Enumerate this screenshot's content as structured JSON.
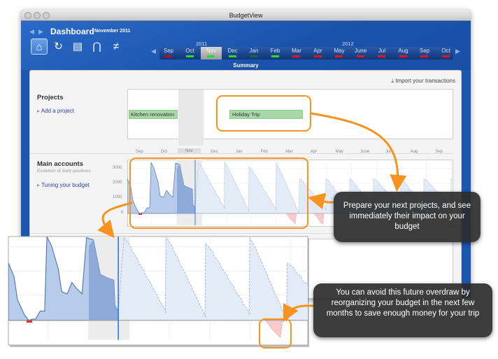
{
  "window": {
    "title": "BudgetView"
  },
  "header": {
    "title": "Dashboard",
    "date": "November 2011",
    "summary": "Summary",
    "tools": [
      {
        "icon": "home-icon",
        "glyph": "⌂"
      },
      {
        "icon": "refresh-icon",
        "glyph": "↻"
      },
      {
        "icon": "document-icon",
        "glyph": "▤"
      },
      {
        "icon": "split-icon",
        "glyph": "⋂"
      },
      {
        "icon": "chart-icon",
        "glyph": "≠"
      }
    ]
  },
  "timeline": {
    "years": [
      "2011",
      "2012"
    ],
    "months": [
      {
        "label": "Sep",
        "status": "#b01010"
      },
      {
        "label": "Oct",
        "status": "#22dd22"
      },
      {
        "label": "Nov",
        "status": "#22dd22",
        "selected": true
      },
      {
        "label": "Dec",
        "status": "#22dd22"
      },
      {
        "label": "Jan",
        "status": "#1d6a1d"
      },
      {
        "label": "Feb",
        "status": "#22dd22"
      },
      {
        "label": "Mar",
        "status": "#ee1111"
      },
      {
        "label": "Apr",
        "status": "#ee1111"
      },
      {
        "label": "May",
        "status": "#ee1111"
      },
      {
        "label": "June",
        "status": "#ee1111"
      },
      {
        "label": "Jul",
        "status": "#ee1111"
      },
      {
        "label": "Aug",
        "status": "#ee1111"
      },
      {
        "label": "Sep",
        "status": "#ee1111"
      },
      {
        "label": "Oct",
        "status": "#ee1111"
      }
    ]
  },
  "import": "Import your transactions",
  "projects": {
    "title": "Projects",
    "add": "Add a project",
    "items": [
      "Kitchen renovation",
      "Holiday Trip"
    ],
    "months": [
      "Sep",
      "Oct",
      "Nov",
      "Dec",
      "Jan",
      "Feb",
      "Mar",
      "Apr",
      "May",
      "June",
      "Jul",
      "Aug",
      "Sep"
    ]
  },
  "accounts": {
    "title": "Main accounts",
    "subtitle": "Evolution of daily positions",
    "tuning": "Tuning your budget",
    "yticks": [
      "3000",
      "2000",
      "1000",
      "0"
    ]
  },
  "callouts": [
    "Prepare your next projects, and see immediately their impact on your budget",
    "You can avoid this future overdraw by reorganizing your budget in the next few months to save enough money for your trip"
  ],
  "colors": {
    "accent": "#f7931e",
    "window": "#1d56b0"
  }
}
